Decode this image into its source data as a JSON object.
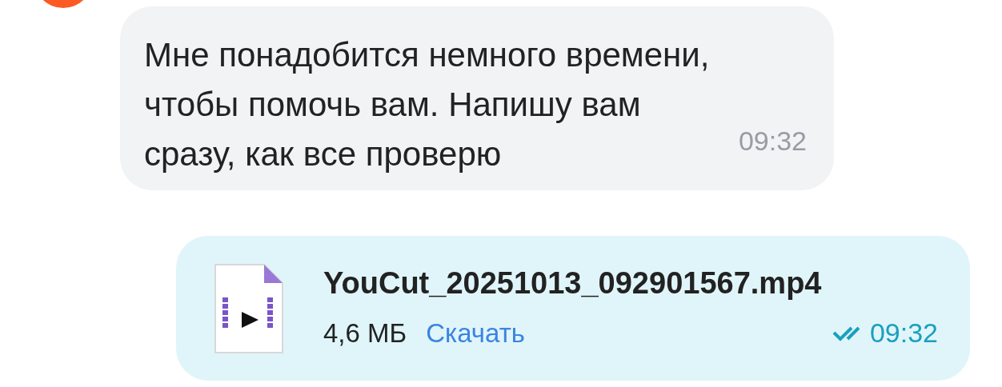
{
  "messages": [
    {
      "kind": "text",
      "outgoing": false,
      "text": "Мне понадобится немного времени, чтобы помочь вам. Напишу вам сразу, как все проверю",
      "time": "09:32"
    },
    {
      "kind": "file",
      "outgoing": true,
      "file_name": "YouCut_20251013_092901567.mp4",
      "size": "4,6 МБ",
      "action": "Скачать",
      "time": "09:32",
      "read": true
    }
  ]
}
